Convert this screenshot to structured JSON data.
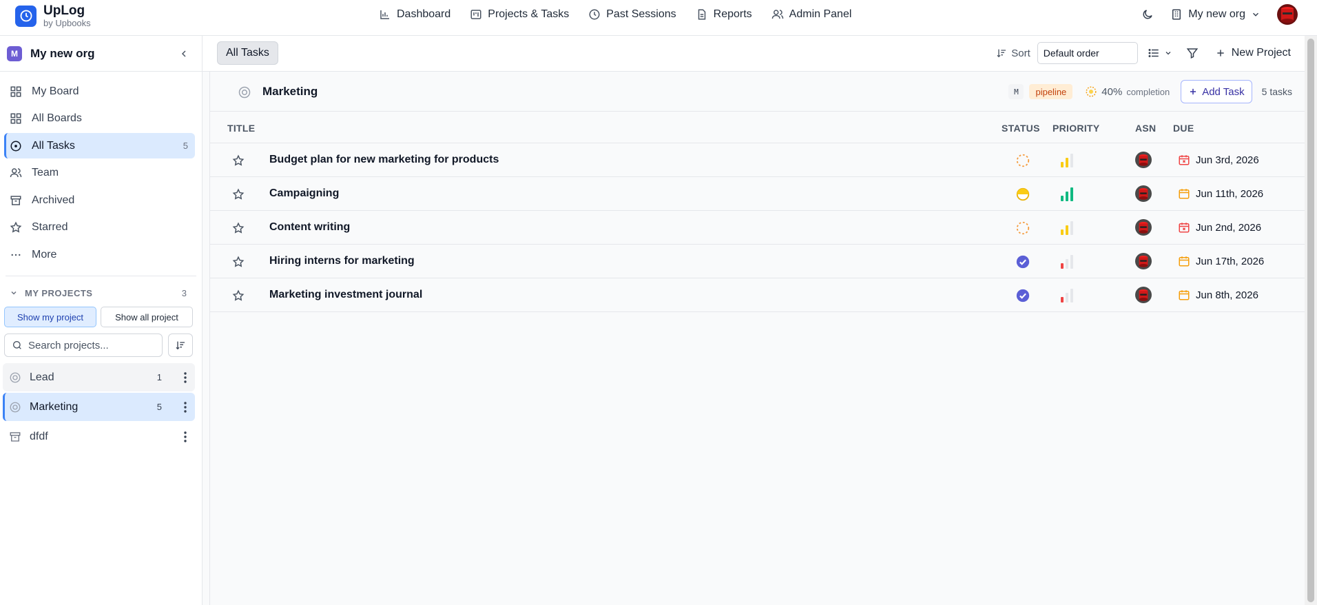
{
  "brand": {
    "name": "UpLog",
    "sub": "by Upbooks"
  },
  "nav": [
    {
      "label": "Dashboard"
    },
    {
      "label": "Projects & Tasks"
    },
    {
      "label": "Past Sessions"
    },
    {
      "label": "Reports"
    },
    {
      "label": "Admin Panel"
    }
  ],
  "org_switch": {
    "label": "My new org"
  },
  "sidebar": {
    "org_badge": "M",
    "org_name": "My new org",
    "menu": [
      {
        "label": "My Board",
        "count": ""
      },
      {
        "label": "All Boards",
        "count": ""
      },
      {
        "label": "All Tasks",
        "count": "5"
      },
      {
        "label": "Team",
        "count": ""
      },
      {
        "label": "Archived",
        "count": ""
      },
      {
        "label": "Starred",
        "count": ""
      },
      {
        "label": "More",
        "count": ""
      }
    ],
    "projects_header": "MY PROJECTS",
    "projects_count": "3",
    "show_my": "Show my project",
    "show_all": "Show all project",
    "search_placeholder": "Search projects...",
    "projects": [
      {
        "name": "Lead",
        "count": "1"
      },
      {
        "name": "Marketing",
        "count": "5"
      },
      {
        "name": "dfdf",
        "count": ""
      }
    ]
  },
  "toolbar": {
    "tab": "All Tasks",
    "sort_label": "Sort",
    "sort_value": "Default order",
    "new_project": "New Project"
  },
  "project": {
    "title": "Marketing",
    "badge_m": "M",
    "tag": "pipeline",
    "completion_pct": "40%",
    "completion_label": "completion",
    "add_task": "Add Task",
    "task_count": "5 tasks"
  },
  "columns": {
    "title": "TITLE",
    "status": "STATUS",
    "priority": "PRIORITY",
    "asn": "ASN",
    "due": "DUE"
  },
  "tasks": [
    {
      "title": "Budget plan for new marketing for products",
      "status": "todo",
      "priority": "medium",
      "due": "Jun 3rd, 2026",
      "due_state": "overdue"
    },
    {
      "title": "Campaigning",
      "status": "in-progress",
      "priority": "high",
      "due": "Jun 11th, 2026",
      "due_state": "upcoming"
    },
    {
      "title": "Content writing",
      "status": "todo",
      "priority": "medium",
      "due": "Jun 2nd, 2026",
      "due_state": "overdue"
    },
    {
      "title": "Hiring interns for marketing",
      "status": "done",
      "priority": "low",
      "due": "Jun 17th, 2026",
      "due_state": "upcoming"
    },
    {
      "title": "Marketing investment journal",
      "status": "done",
      "priority": "low",
      "due": "Jun 8th, 2026",
      "due_state": "upcoming"
    }
  ],
  "colors": {
    "accent": "#3b82f6",
    "active_bg": "#dbeafe",
    "done": "#5b5fd6",
    "todo": "#f59e42",
    "in_progress": "#facc15",
    "prio_high": "#10b981",
    "prio_medium": "#facc15",
    "prio_low": "#ef4444",
    "overdue": "#ef4444",
    "upcoming": "#f59e0b"
  }
}
